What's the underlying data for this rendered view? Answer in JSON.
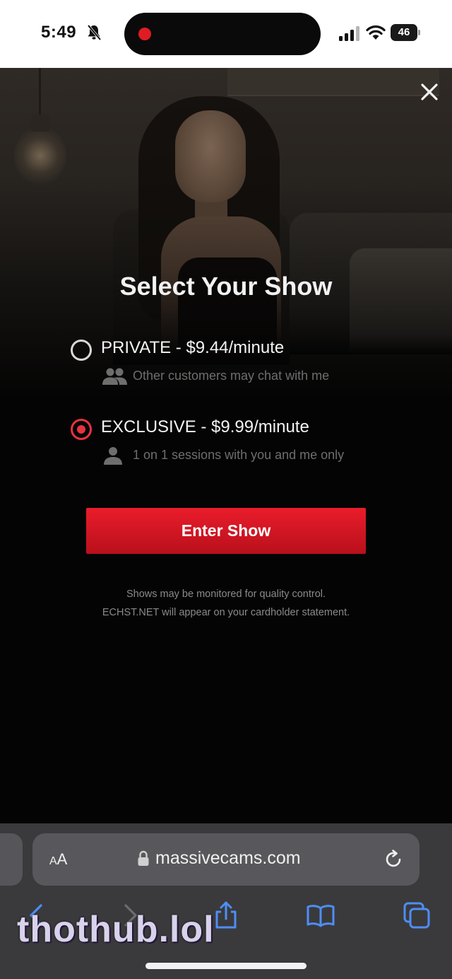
{
  "status_bar": {
    "time": "5:49",
    "battery": "46",
    "recording_color": "#e01b24"
  },
  "modal": {
    "title": "Select Your Show",
    "options": [
      {
        "label": "PRIVATE - $9.44/minute",
        "description": "Other customers may chat with me",
        "icon": "group-icon",
        "selected": false
      },
      {
        "label": "EXCLUSIVE - $9.99/minute",
        "description": "1 on 1 sessions with you and me only",
        "icon": "person-icon",
        "selected": true
      }
    ],
    "enter_button": "Enter Show",
    "legal_line1": "Shows may be monitored for quality control.",
    "legal_line2": "ECHST.NET will appear on your cardholder statement.",
    "accent_color": "#e8323f"
  },
  "browser": {
    "aa_label_small": "A",
    "aa_label_big": "A",
    "url": "massivecams.com",
    "toolbar": [
      "back-icon",
      "forward-icon",
      "share-icon",
      "bookmarks-icon",
      "tabs-icon"
    ]
  },
  "watermark": "thothub.lol"
}
